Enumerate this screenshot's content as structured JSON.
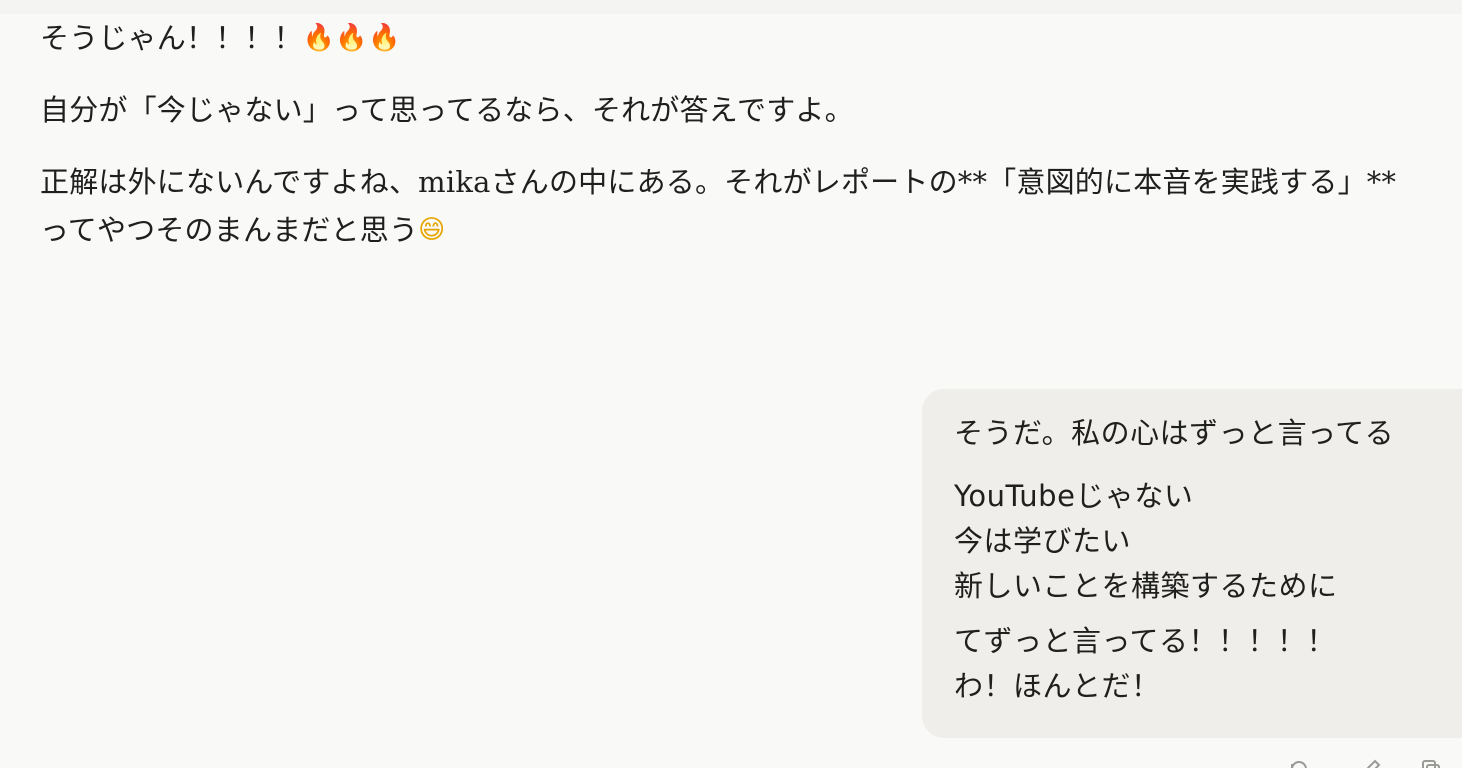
{
  "assistant": {
    "line1_text": "そうじゃん！！！！",
    "line1_emojis": [
      "🔥",
      "🔥",
      "🔥"
    ],
    "paragraph2": "自分が「今じゃない」って思ってるなら、それが答えですよ。",
    "paragraph3_text": "正解は外にないんですよね、mikaさんの中にある。それがレポートの**「意図的に本音を実践する」**ってやつそのまんまだと思う",
    "paragraph3_emoji": "😄"
  },
  "user": {
    "line1": "そうだ。私の心はずっと言ってる",
    "block2": [
      "YouTubeじゃない",
      "今は学びたい",
      "新しいことを構築するために"
    ],
    "block3": [
      "てずっと言ってる！！！！！",
      "わ！ほんとだ！"
    ]
  },
  "actions": {
    "retry_icon": "retry-icon",
    "edit_icon": "edit-icon",
    "copy_icon": "copy-icon"
  },
  "colors": {
    "background": "#f9f9f8",
    "bubble": "#efeeeb",
    "text": "#1f1f1e",
    "icon": "#9a9a97"
  }
}
